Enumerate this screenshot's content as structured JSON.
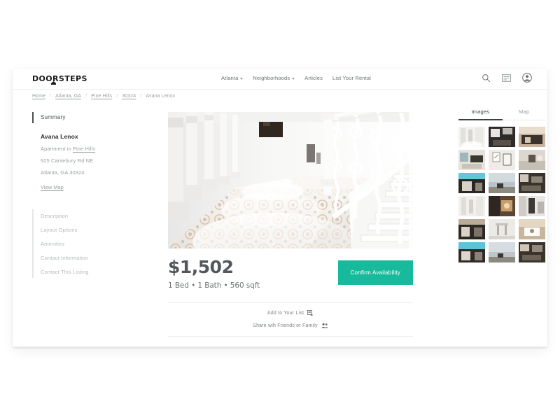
{
  "header": {
    "logo_text": "DOORSTEPS",
    "nav": [
      {
        "label": "Atlanta",
        "has_caret": true
      },
      {
        "label": "Neighborhoods",
        "has_caret": true
      },
      {
        "label": "Articles",
        "has_caret": false
      },
      {
        "label": "List Your Rental",
        "has_caret": false
      }
    ],
    "icons": [
      {
        "name": "search-icon"
      },
      {
        "name": "list-icon"
      },
      {
        "name": "account-icon"
      }
    ]
  },
  "breadcrumb": [
    {
      "label": "Home",
      "link": true
    },
    {
      "label": "Atlanta, GA",
      "link": true
    },
    {
      "label": "Pine Hills",
      "link": true
    },
    {
      "label": "30324",
      "link": true
    },
    {
      "label": "Avana Lenox",
      "link": false
    }
  ],
  "breadcrumb_separator": "/",
  "sidebar": {
    "summary_label": "Summary",
    "listing_name": "Avana Lenox",
    "apartment_prefix": "Apartment in ",
    "neighborhood": "Pine Hills",
    "street": "925 Cantebury Rd NE",
    "city_state_zip": "Atlanta, GA 30324",
    "view_map": "View Map",
    "nav_items": [
      {
        "label": "Description"
      },
      {
        "label": "Layout Options"
      },
      {
        "label": "Amenities"
      },
      {
        "label": "Contact Information"
      },
      {
        "label": "Contact This Listing"
      }
    ]
  },
  "listing": {
    "hero_alt": "white-hallway-tiled-floor-staircase",
    "price": "$1,502",
    "specs": "1 Bed • 1 Bath • 560 sqft",
    "cta_label": "Confirm Availability",
    "add_to_list_label": "Add to Your List",
    "share_label": "Share wih Friends or Family"
  },
  "gallery": {
    "tabs": [
      {
        "label": "Images",
        "active": true
      },
      {
        "label": "Map",
        "active": false
      }
    ],
    "thumbnail_count": 18,
    "selected_index": 0
  },
  "colors": {
    "accent_teal": "#17bb9c",
    "text_dark": "#2b2f31",
    "text_muted": "#9aa0a2",
    "rule": "#eceeef"
  }
}
